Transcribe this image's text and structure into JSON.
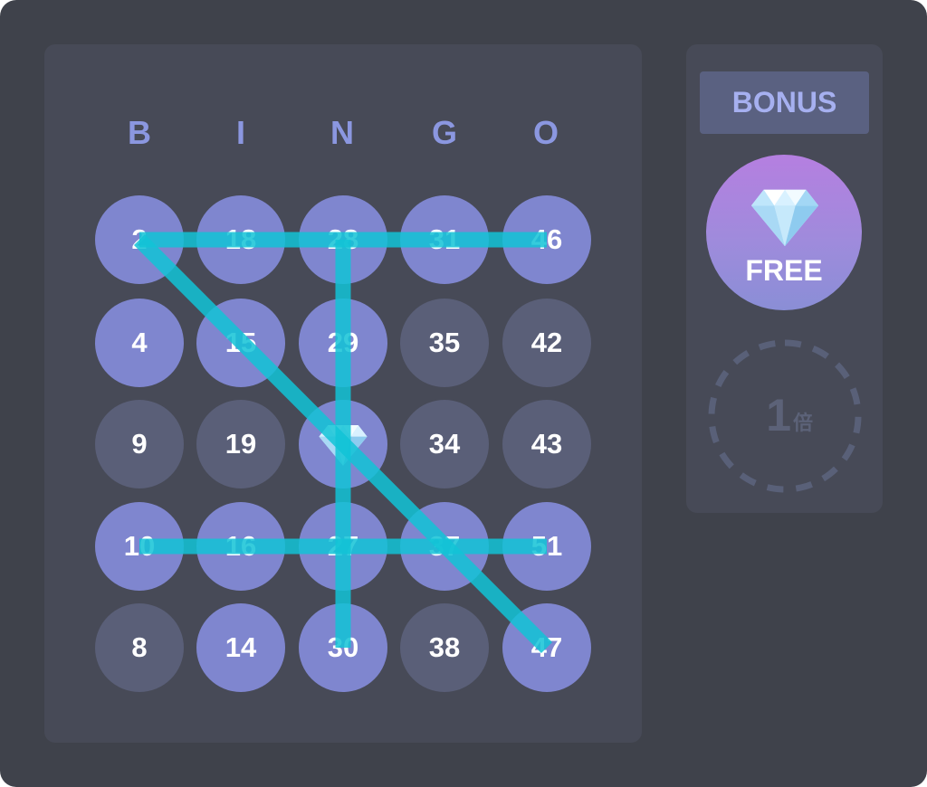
{
  "header": {
    "letters": [
      "B",
      "I",
      "N",
      "G",
      "O"
    ]
  },
  "grid": {
    "rows": [
      [
        {
          "value": "2",
          "marked": true
        },
        {
          "value": "18",
          "marked": true
        },
        {
          "value": "28",
          "marked": true
        },
        {
          "value": "31",
          "marked": true
        },
        {
          "value": "46",
          "marked": true
        }
      ],
      [
        {
          "value": "4",
          "marked": true
        },
        {
          "value": "15",
          "marked": true
        },
        {
          "value": "29",
          "marked": true
        },
        {
          "value": "35",
          "marked": false
        },
        {
          "value": "42",
          "marked": false
        }
      ],
      [
        {
          "value": "9",
          "marked": false
        },
        {
          "value": "19",
          "marked": false
        },
        {
          "value": "",
          "marked": true,
          "icon": "diamond-icon"
        },
        {
          "value": "34",
          "marked": false
        },
        {
          "value": "43",
          "marked": false
        }
      ],
      [
        {
          "value": "10",
          "marked": true
        },
        {
          "value": "16",
          "marked": true
        },
        {
          "value": "27",
          "marked": true
        },
        {
          "value": "37",
          "marked": true
        },
        {
          "value": "51",
          "marked": true
        }
      ],
      [
        {
          "value": "8",
          "marked": false
        },
        {
          "value": "14",
          "marked": true
        },
        {
          "value": "30",
          "marked": true
        },
        {
          "value": "38",
          "marked": false
        },
        {
          "value": "47",
          "marked": true
        }
      ]
    ]
  },
  "winning_lines": [
    {
      "name": "top-row",
      "from": [
        0,
        0
      ],
      "to": [
        0,
        4
      ]
    },
    {
      "name": "fourth-row",
      "from": [
        3,
        0
      ],
      "to": [
        3,
        4
      ]
    },
    {
      "name": "middle-column",
      "from": [
        0,
        2
      ],
      "to": [
        4,
        2
      ]
    },
    {
      "name": "diagonal",
      "from": [
        0,
        0
      ],
      "to": [
        4,
        4
      ]
    }
  ],
  "sidebar": {
    "bonus_label": "BONUS",
    "free_label": "FREE",
    "free_icon": "diamond-icon",
    "multiplier_value": "1",
    "multiplier_unit": "倍"
  },
  "colors": {
    "marked": "#7f86cf",
    "unmarked": "#5a5f78",
    "line": "#12c3d6",
    "letter": "#8b97e0"
  }
}
